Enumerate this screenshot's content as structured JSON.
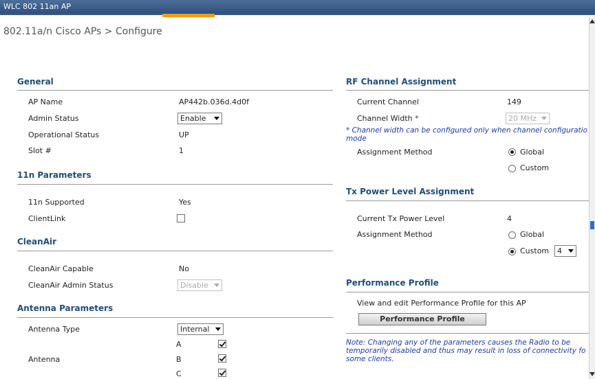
{
  "window": {
    "title": "WLC 802 11an AP"
  },
  "page": {
    "title": "802.11a/n Cisco APs > Configure"
  },
  "general": {
    "title": "General",
    "ap_name_label": "AP Name",
    "ap_name_value": "AP442b.036d.4d0f",
    "admin_status_label": "Admin Status",
    "admin_status_value": "Enable",
    "operational_status_label": "Operational Status",
    "operational_status_value": "UP",
    "slot_label": "Slot #",
    "slot_value": "1"
  },
  "n11": {
    "title": "11n Parameters",
    "supported_label": "11n Supported",
    "supported_value": "Yes",
    "clientlink_label": "ClientLink",
    "clientlink_checked": false
  },
  "cleanair": {
    "title": "CleanAir",
    "capable_label": "CleanAir Capable",
    "capable_value": "No",
    "admin_status_label": "CleanAir Admin Status",
    "admin_status_value": "Disable"
  },
  "antenna": {
    "title": "Antenna Parameters",
    "type_label": "Antenna Type",
    "type_value": "Internal",
    "antenna_label": "Antenna",
    "items": [
      {
        "label": "A",
        "checked": true
      },
      {
        "label": "B",
        "checked": true
      },
      {
        "label": "C",
        "checked": true
      }
    ]
  },
  "rf": {
    "title": "RF Channel Assignment",
    "current_channel_label": "Current Channel",
    "current_channel_value": "149",
    "channel_width_label": "Channel Width",
    "channel_width_asterisk": "*",
    "channel_width_value": "20 MHz",
    "note_line1": "* Channel width can be configured only when channel configuratio",
    "note_line2": "mode",
    "assignment_method_label": "Assignment Method",
    "global_label": "Global",
    "custom_label": "Custom",
    "selected": "Global"
  },
  "tx": {
    "title": "Tx Power Level Assignment",
    "current_level_label": "Current Tx Power Level",
    "current_level_value": "4",
    "assignment_method_label": "Assignment Method",
    "global_label": "Global",
    "custom_label": "Custom",
    "custom_value": "4",
    "selected": "Custom"
  },
  "performance": {
    "title": "Performance Profile",
    "description": "View and edit Performance Profile for this AP",
    "button_label": "Performance Profile"
  },
  "footer_note": {
    "line1": "Note: Changing any of the parameters causes the Radio to be",
    "line2": "temporarily disabled and thus may result in loss of connectivity fo",
    "line3": "some clients."
  },
  "colors": {
    "section_title": "#1f4e79",
    "note_blue": "#1c3aa8",
    "titlebar": "#3b5b88",
    "tab_accent": "#f39c12"
  }
}
